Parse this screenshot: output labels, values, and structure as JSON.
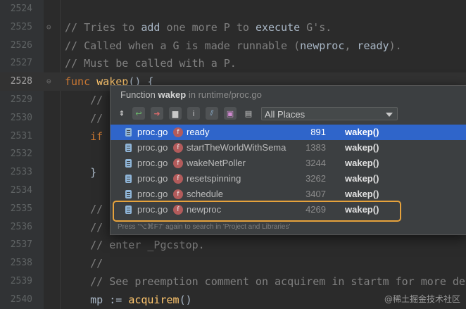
{
  "editor": {
    "lines": [
      {
        "num": "2524",
        "parts": []
      },
      {
        "num": "2525",
        "parts": [
          {
            "t": "// Tries to ",
            "c": "c-com"
          },
          {
            "t": "add",
            "c": "c-plain"
          },
          {
            "t": " one more P to ",
            "c": "c-com"
          },
          {
            "t": "execute",
            "c": "c-plain"
          },
          {
            "t": " G's.",
            "c": "c-com"
          }
        ]
      },
      {
        "num": "2526",
        "parts": [
          {
            "t": "// Called when a G is made runnable (",
            "c": "c-com"
          },
          {
            "t": "newproc",
            "c": "c-plain"
          },
          {
            "t": ", ",
            "c": "c-com"
          },
          {
            "t": "ready",
            "c": "c-plain"
          },
          {
            "t": ").",
            "c": "c-com"
          }
        ]
      },
      {
        "num": "2527",
        "parts": [
          {
            "t": "// Must be called with a P.",
            "c": "c-com"
          }
        ]
      },
      {
        "num": "2528",
        "parts": [
          {
            "t": "func ",
            "c": "c-kw"
          },
          {
            "t": "wakep",
            "c": "c-fn"
          },
          {
            "t": "() {",
            "c": "c-plain"
          }
        ]
      },
      {
        "num": "2529",
        "parts": [
          {
            "t": "    //",
            "c": "c-com"
          }
        ]
      },
      {
        "num": "2530",
        "parts": [
          {
            "t": "    //",
            "c": "c-com"
          }
        ]
      },
      {
        "num": "2531",
        "parts": [
          {
            "t": "    if",
            "c": "c-kw"
          }
        ]
      },
      {
        "num": "2532",
        "parts": []
      },
      {
        "num": "2533",
        "parts": [
          {
            "t": "    }",
            "c": "c-plain"
          }
        ]
      },
      {
        "num": "2534",
        "parts": []
      },
      {
        "num": "2535",
        "parts": [
          {
            "t": "    //",
            "c": "c-com"
          }
        ]
      },
      {
        "num": "2536",
        "parts": [
          {
            "t": "    //",
            "c": "c-com"
          }
        ]
      },
      {
        "num": "2537",
        "parts": [
          {
            "t": "    // enter _Pgcstop.",
            "c": "c-com"
          }
        ]
      },
      {
        "num": "2538",
        "parts": [
          {
            "t": "    //",
            "c": "c-com"
          }
        ]
      },
      {
        "num": "2539",
        "parts": [
          {
            "t": "    // See preemption comment on acquirem in startm for more det",
            "c": "c-com"
          }
        ]
      },
      {
        "num": "2540",
        "parts": [
          {
            "t": "    mp := ",
            "c": "c-plain"
          },
          {
            "t": "acquirem",
            "c": "c-fn"
          },
          {
            "t": "()",
            "c": "c-plain"
          }
        ]
      }
    ]
  },
  "popup": {
    "title_prefix": "Function ",
    "function_name": "wakep",
    "title_suffix": " in runtime/proc.go",
    "scope_selected": "All Places",
    "toolbar_icons": [
      "pin-icon",
      "jump-to-source-icon",
      "move-to-icon",
      "folder-icon",
      "info-icon",
      "filter-icon",
      "regex-icon",
      "window-icon"
    ],
    "results": [
      {
        "file": "proc.go",
        "caller": "ready",
        "line": "891",
        "target": "wakep()",
        "selected": true
      },
      {
        "file": "proc.go",
        "caller": "startTheWorldWithSema",
        "line": "1383",
        "target": "wakep()",
        "selected": false
      },
      {
        "file": "proc.go",
        "caller": "wakeNetPoller",
        "line": "3244",
        "target": "wakep()",
        "selected": false
      },
      {
        "file": "proc.go",
        "caller": "resetspinning",
        "line": "3262",
        "target": "wakep()",
        "selected": false
      },
      {
        "file": "proc.go",
        "caller": "schedule",
        "line": "3407",
        "target": "wakep()",
        "selected": false
      },
      {
        "file": "proc.go",
        "caller": "newproc",
        "line": "4269",
        "target": "wakep()",
        "selected": false
      }
    ],
    "badge_letter": "f",
    "hint": "Press '⌥⌘F7' again to search in 'Project and Libraries'"
  },
  "watermark": "@稀土掘金技术社区",
  "colors": {
    "accent": "#e6a23c",
    "selection": "#2f65ca"
  }
}
